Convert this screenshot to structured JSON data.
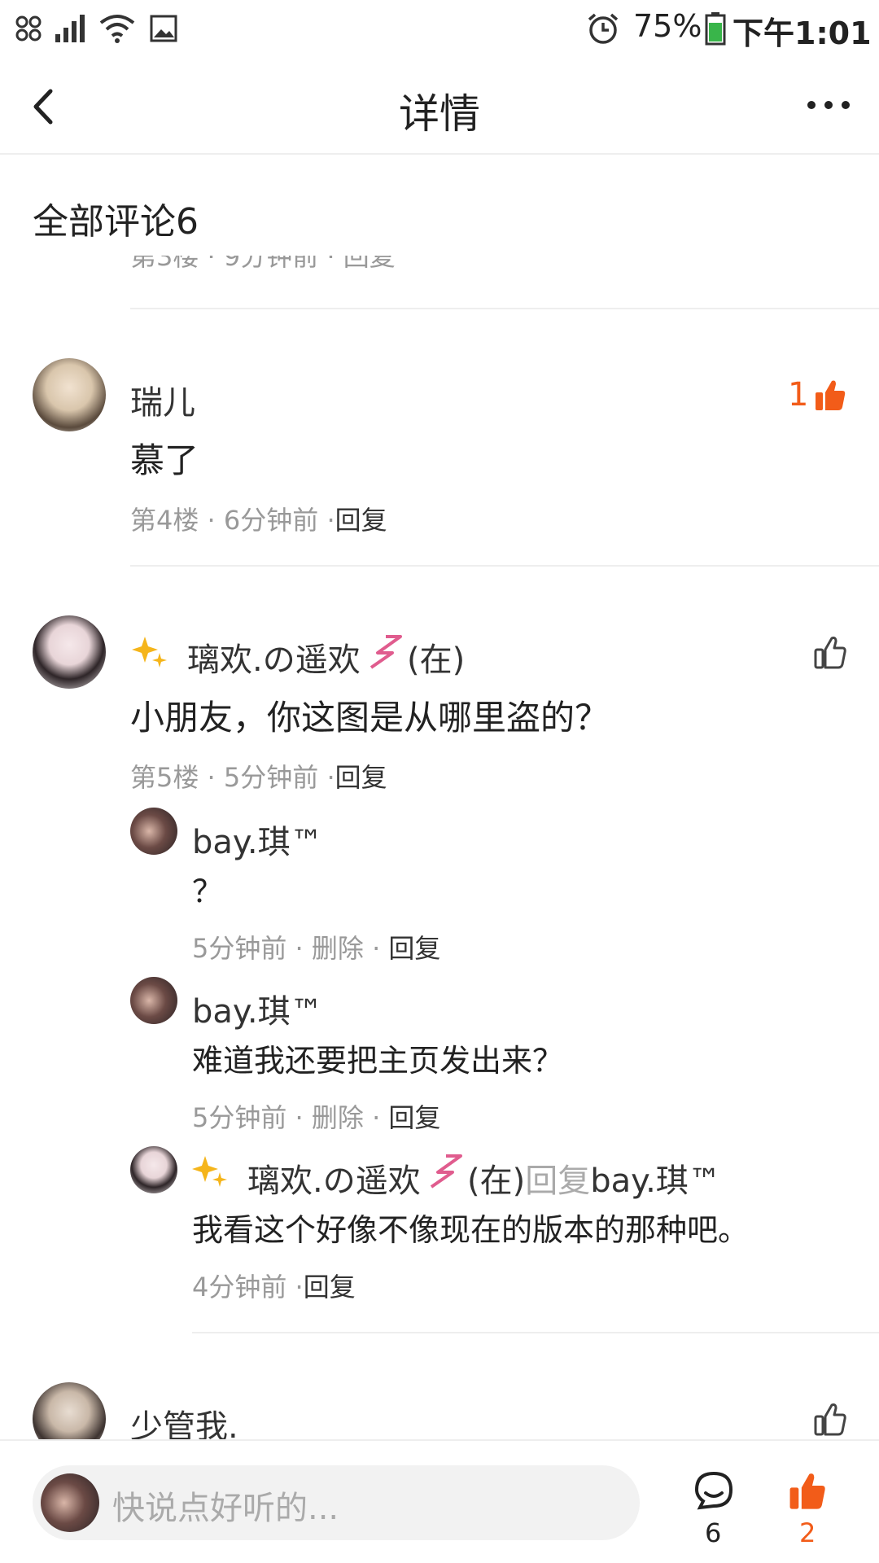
{
  "status_bar": {
    "battery": "75%",
    "time": "下午1:01"
  },
  "header": {
    "title": "详情"
  },
  "comments_header": "全部评论6",
  "truncated_row": "第3楼 · 9分钟前 · 回复",
  "comments": [
    {
      "user": "瑞儿",
      "text": "慕了",
      "floor": "第4楼",
      "time": "6分钟前",
      "reply_label": "回复",
      "likes": "1"
    },
    {
      "user": "璃欢.の遥欢",
      "user_suffix": "(在)",
      "text": "小朋友，你这图是从哪里盗的？",
      "floor": "第5楼",
      "time": "5分钟前",
      "reply_label": "回复",
      "replies": [
        {
          "user": "bay.琪™",
          "text": "？",
          "time": "5分钟前",
          "delete_label": "删除",
          "reply_label": "回复"
        },
        {
          "user": "bay.琪™",
          "text": "难道我还要把主页发出来？",
          "time": "5分钟前",
          "delete_label": "删除",
          "reply_label": "回复"
        },
        {
          "user": "璃欢.の遥欢",
          "user_suffix": "(在)",
          "reply_word": "回复",
          "reply_to": "bay.琪™",
          "text": "我看这个好像不像现在的版本的那种吧。",
          "time": "4分钟前",
          "reply_label": "回复"
        }
      ]
    },
    {
      "user": "少管我."
    }
  ],
  "bottom_bar": {
    "placeholder": "快说点好听的...",
    "comment_count": "6",
    "like_count": "2"
  },
  "colors": {
    "accent": "#F25C19",
    "gray_text": "#999999"
  }
}
